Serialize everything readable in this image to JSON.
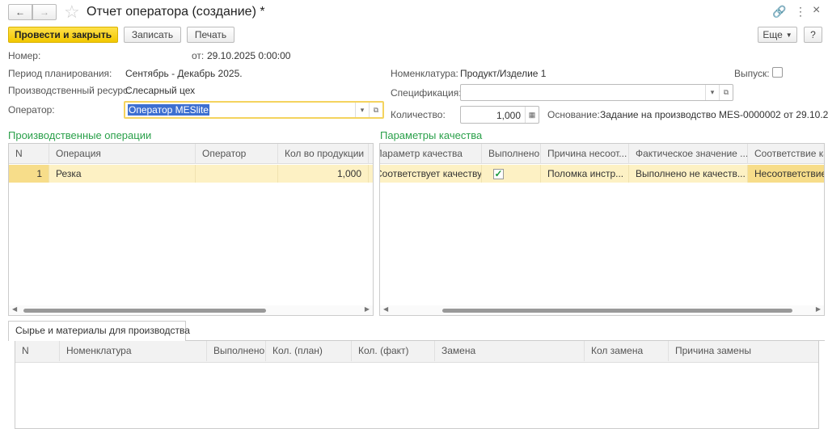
{
  "window": {
    "title": "Отчет оператора (создание) *"
  },
  "toolbar": {
    "post_close": "Провести и закрыть",
    "save": "Записать",
    "print": "Печать",
    "more": "Еще",
    "help": "?"
  },
  "header": {
    "number_label": "Номер:",
    "date_label": "от:",
    "date_value": "29.10.2025 0:00:00",
    "period_label": "Период планирования:",
    "period_value": "Сентябрь - Декабрь 2025.",
    "resource_label": "Производственный ресурс:",
    "resource_value": "Слесарный цех",
    "operator_label": "Оператор:",
    "operator_value": "Оператор MESlite",
    "nomenclature_label": "Номенклатура:",
    "nomenclature_value": "Продукт/Изделие 1",
    "output_label": "Выпуск:",
    "output_checked": false,
    "spec_label": "Спецификация:",
    "spec_value": "",
    "qty_label": "Количество:",
    "qty_value": "1,000",
    "basis_label": "Основание:",
    "basis_value": "Задание на производство MES-0000002 от 29.10.2..."
  },
  "operations": {
    "title": "Производственные операции",
    "columns": [
      "N",
      "Операция",
      "Оператор",
      "Кол во продукции"
    ],
    "rows": [
      {
        "n": "1",
        "operation": "Резка",
        "operator": "",
        "qty": "1,000"
      }
    ]
  },
  "quality": {
    "title": "Параметры качества",
    "columns": [
      "Параметр качества",
      "Выполнено",
      "Причина несоот...",
      "Фактическое значение ...",
      "Соответствие кач"
    ],
    "rows": [
      {
        "param": "Соответствует качеству",
        "done": true,
        "reason": "Поломка инстр...",
        "actual": "Выполнено не качеств...",
        "conformity": "Несоответствие"
      }
    ]
  },
  "materials": {
    "tab": "Сырье и материалы для производства",
    "columns": [
      "N",
      "Номенклатура",
      "Выполнено",
      "Кол. (план)",
      "Кол. (факт)",
      "Замена",
      "Кол замена",
      "Причина замены"
    ]
  }
}
